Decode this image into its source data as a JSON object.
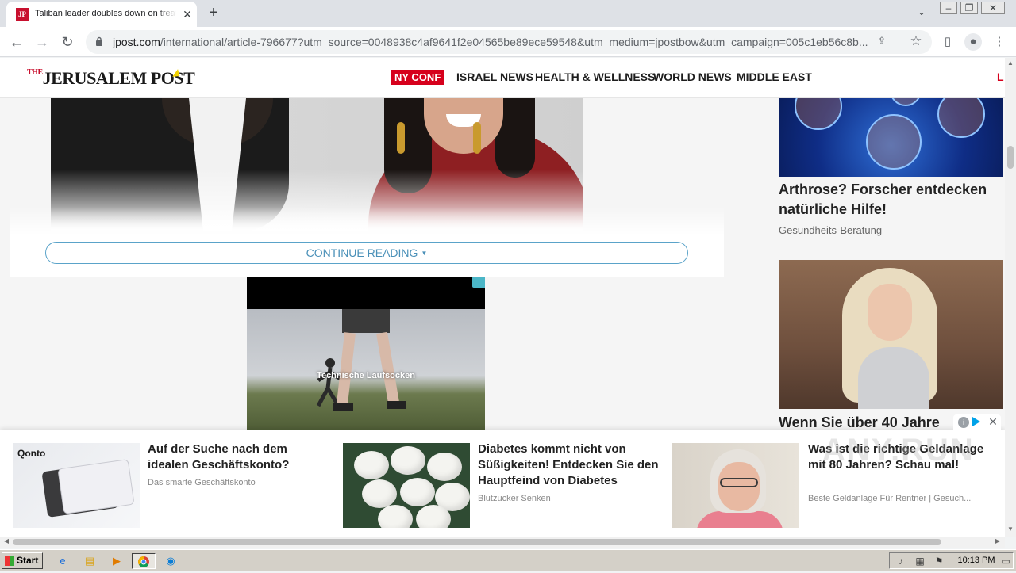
{
  "browser": {
    "tab_title": "Taliban leader doubles down on treat",
    "tab_close": "✕",
    "new_tab": "+",
    "url_host": "jpost.com",
    "url_path": "/international/article-796677?utm_source=0048938c4af9641f2e04565be89ece59548&utm_medium=jpostbow&utm_campaign=005c1eb56c8b..."
  },
  "site": {
    "logo_the": "THE",
    "logo_name": "JERUSALEM POST",
    "nav": {
      "ny_conf": "NY CONF",
      "israel_news": "ISRAEL NEWS",
      "health": "HEALTH & WELLNESS",
      "world_news": "WORLD NEWS",
      "middle_east": "MIDDLE EAST",
      "extra": "L"
    }
  },
  "article": {
    "continue_label": "CONTINUE READING"
  },
  "video_ad": {
    "caption": "Technische Laufsocken"
  },
  "sidebar": {
    "ad1_title": "Arthrose? Forscher entdecken natürliche Hilfe!",
    "ad1_source": "Gesundheits-Beratung",
    "ad2_title": "Wenn Sie über 40 Jahre"
  },
  "bottom_ad": {
    "cards": [
      {
        "title": "Auf der Suche nach dem idealen Geschäftskonto?",
        "source": "Das smarte Geschäftskonto",
        "brand": "Qonto"
      },
      {
        "title": "Diabetes kommt nicht von Süßigkeiten! Entdecken Sie den Hauptfeind von Diabetes",
        "source": "Blutzucker Senken"
      },
      {
        "title": "Was ist die richtige Geldanlage mit 80 Jahren? Schau mal!",
        "source": "Beste Geldanlage Für Rentner | Gesuch..."
      }
    ]
  },
  "watermark": "ANY.RUN",
  "taskbar": {
    "start_label": "Start",
    "clock": "10:13 PM"
  }
}
